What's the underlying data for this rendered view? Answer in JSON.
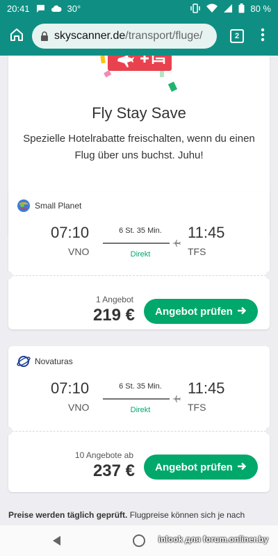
{
  "status_bar": {
    "time": "20:41",
    "temperature": "30°",
    "battery": "80 %"
  },
  "browser": {
    "url_host": "skyscanner.de",
    "url_path": "/transport/fluge/",
    "tabs_count": "2"
  },
  "promo": {
    "title": "Fly Stay Save",
    "text": "Spezielle Hotelrabatte freischalten, wenn du einen Flug über uns buchst. Juhu!"
  },
  "results": [
    {
      "airline": "Small Planet",
      "depart_time": "07:10",
      "depart_code": "VNO",
      "arrive_time": "11:45",
      "arrive_code": "TFS",
      "duration": "6 St. 35 Min.",
      "stops": "Direkt",
      "offers": "1 Angebot",
      "price": "219 €",
      "cta": "Angebot prüfen"
    },
    {
      "airline": "Novaturas",
      "depart_time": "07:10",
      "depart_code": "VNO",
      "arrive_time": "11:45",
      "arrive_code": "TFS",
      "duration": "6 St. 35 Min.",
      "stops": "Direkt",
      "offers": "10 Angebote ab",
      "price": "237 €",
      "cta": "Angebot prüfen"
    }
  ],
  "disclaimer": {
    "bold": "Preise werden täglich geprüft.",
    "rest": " Flugpreise können sich je nach"
  },
  "watermark": "inlook для forum.onliner.by",
  "colors": {
    "brand_teal": "#0f8f84",
    "cta_green": "#00a86b",
    "promo_red": "#e8424e"
  }
}
